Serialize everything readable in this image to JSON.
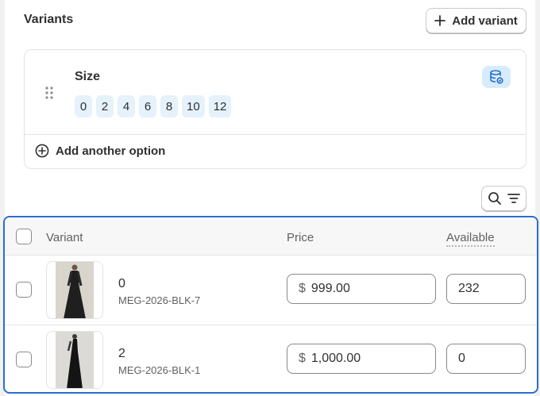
{
  "variants_card": {
    "title": "Variants",
    "add_variant_label": "Add variant"
  },
  "option": {
    "name": "Size",
    "values": [
      "0",
      "2",
      "4",
      "6",
      "8",
      "10",
      "12"
    ],
    "add_another_label": "Add another option"
  },
  "table": {
    "headers": {
      "variant": "Variant",
      "price": "Price",
      "available": "Available"
    },
    "rows": [
      {
        "name": "0",
        "sku": "MEG-2026-BLK-7",
        "currency": "$",
        "price": "999.00",
        "available": "232"
      },
      {
        "name": "2",
        "sku": "MEG-2026-BLK-1",
        "currency": "$",
        "price": "1,000.00",
        "available": "0"
      }
    ]
  },
  "colors": {
    "accent_blue": "#2c6ecb",
    "chip_bg": "#e5f1fb",
    "db_icon_bg": "#d6ecfd"
  },
  "icons": [
    "plus-icon",
    "drag-handle-icon",
    "database-icon",
    "plus-circle-icon",
    "search-icon",
    "filter-icon",
    "dress-thumbnail"
  ]
}
